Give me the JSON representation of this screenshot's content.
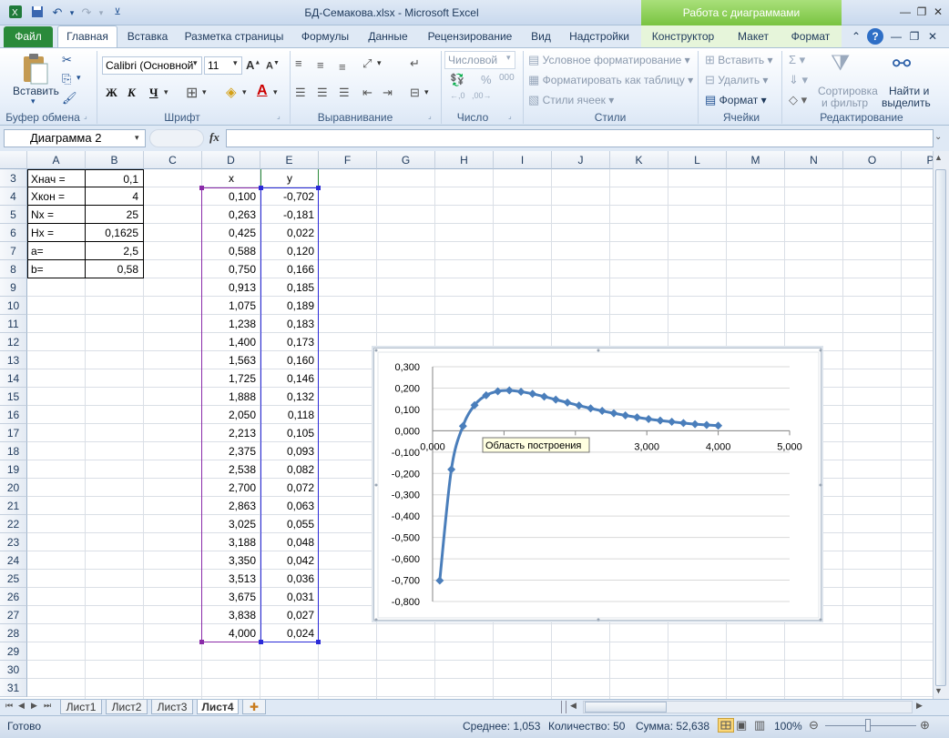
{
  "window": {
    "title": "БД-Семакова.xlsx - Microsoft Excel",
    "context_band": "Работа с диаграммами"
  },
  "tabs": [
    "Файл",
    "Главная",
    "Вставка",
    "Разметка страницы",
    "Формулы",
    "Данные",
    "Рецензирование",
    "Вид",
    "Надстройки",
    "Конструктор",
    "Макет",
    "Формат"
  ],
  "ribbon": {
    "paste": "Вставить",
    "font_name": "Calibri (Основной",
    "font_size": "11",
    "bold": "Ж",
    "italic": "К",
    "underline": "Ч",
    "number_format": "Числовой",
    "cond_format": "Условное форматирование",
    "format_table": "Форматировать как таблицу",
    "cell_styles": "Стили ячеек",
    "insert": "Вставить",
    "delete": "Удалить",
    "format": "Формат",
    "sort_filter_1": "Сортировка",
    "sort_filter_2": "и фильтр",
    "find_1": "Найти и",
    "find_2": "выделить",
    "groups": [
      "Буфер обмена",
      "Шрифт",
      "Выравнивание",
      "Число",
      "Стили",
      "Ячейки",
      "Редактирование"
    ]
  },
  "formula_bar": {
    "name_box": "Диаграмма 2",
    "fx": "fx"
  },
  "columns": [
    "A",
    "B",
    "C",
    "D",
    "E",
    "F",
    "G",
    "H",
    "I",
    "J",
    "K",
    "L",
    "M",
    "N",
    "O",
    "P"
  ],
  "rows": [
    "3",
    "4",
    "5",
    "6",
    "7",
    "8",
    "9",
    "10",
    "11",
    "12",
    "13",
    "14",
    "15",
    "16",
    "17",
    "18",
    "19",
    "20",
    "21",
    "22",
    "23",
    "24",
    "25",
    "26",
    "27",
    "28",
    "29",
    "30",
    "31"
  ],
  "params": [
    [
      "Xнач =",
      "0,1"
    ],
    [
      "Xкон =",
      "4"
    ],
    [
      "Nx =",
      "25"
    ],
    [
      "Hx =",
      "0,1625"
    ],
    [
      "a=",
      "2,5"
    ],
    [
      "b=",
      "0,58"
    ]
  ],
  "table_header": [
    "x",
    "y"
  ],
  "table": [
    [
      "0,100",
      "-0,702"
    ],
    [
      "0,263",
      "-0,181"
    ],
    [
      "0,425",
      "0,022"
    ],
    [
      "0,588",
      "0,120"
    ],
    [
      "0,750",
      "0,166"
    ],
    [
      "0,913",
      "0,185"
    ],
    [
      "1,075",
      "0,189"
    ],
    [
      "1,238",
      "0,183"
    ],
    [
      "1,400",
      "0,173"
    ],
    [
      "1,563",
      "0,160"
    ],
    [
      "1,725",
      "0,146"
    ],
    [
      "1,888",
      "0,132"
    ],
    [
      "2,050",
      "0,118"
    ],
    [
      "2,213",
      "0,105"
    ],
    [
      "2,375",
      "0,093"
    ],
    [
      "2,538",
      "0,082"
    ],
    [
      "2,700",
      "0,072"
    ],
    [
      "2,863",
      "0,063"
    ],
    [
      "3,025",
      "0,055"
    ],
    [
      "3,188",
      "0,048"
    ],
    [
      "3,350",
      "0,042"
    ],
    [
      "3,513",
      "0,036"
    ],
    [
      "3,675",
      "0,031"
    ],
    [
      "3,838",
      "0,027"
    ],
    [
      "4,000",
      "0,024"
    ]
  ],
  "chart_data": {
    "type": "scatter",
    "tooltip": "Область построения",
    "xlim": [
      0,
      5
    ],
    "ylim": [
      -0.8,
      0.3
    ],
    "x_ticks": [
      "0,000",
      "1,000",
      "2,000",
      "3,000",
      "4,000",
      "5,000"
    ],
    "y_ticks": [
      "0,300",
      "0,200",
      "0,100",
      "0,000",
      "-0,100",
      "-0,200",
      "-0,300",
      "-0,400",
      "-0,500",
      "-0,600",
      "-0,700",
      "-0,800"
    ],
    "grid": true,
    "color": "#4a7ebb",
    "x": [
      0.1,
      0.263,
      0.425,
      0.588,
      0.75,
      0.913,
      1.075,
      1.238,
      1.4,
      1.563,
      1.725,
      1.888,
      2.05,
      2.213,
      2.375,
      2.538,
      2.7,
      2.863,
      3.025,
      3.188,
      3.35,
      3.513,
      3.675,
      3.838,
      4.0
    ],
    "y": [
      -0.702,
      -0.181,
      0.022,
      0.12,
      0.166,
      0.185,
      0.189,
      0.183,
      0.173,
      0.16,
      0.146,
      0.132,
      0.118,
      0.105,
      0.093,
      0.082,
      0.072,
      0.063,
      0.055,
      0.048,
      0.042,
      0.036,
      0.031,
      0.027,
      0.024
    ]
  },
  "sheets": [
    "Лист1",
    "Лист2",
    "Лист3",
    "Лист4"
  ],
  "status": {
    "ready": "Готово",
    "avg": "Среднее: 1,053",
    "count": "Количество: 50",
    "sum": "Сумма: 52,638",
    "zoom": "100%"
  }
}
